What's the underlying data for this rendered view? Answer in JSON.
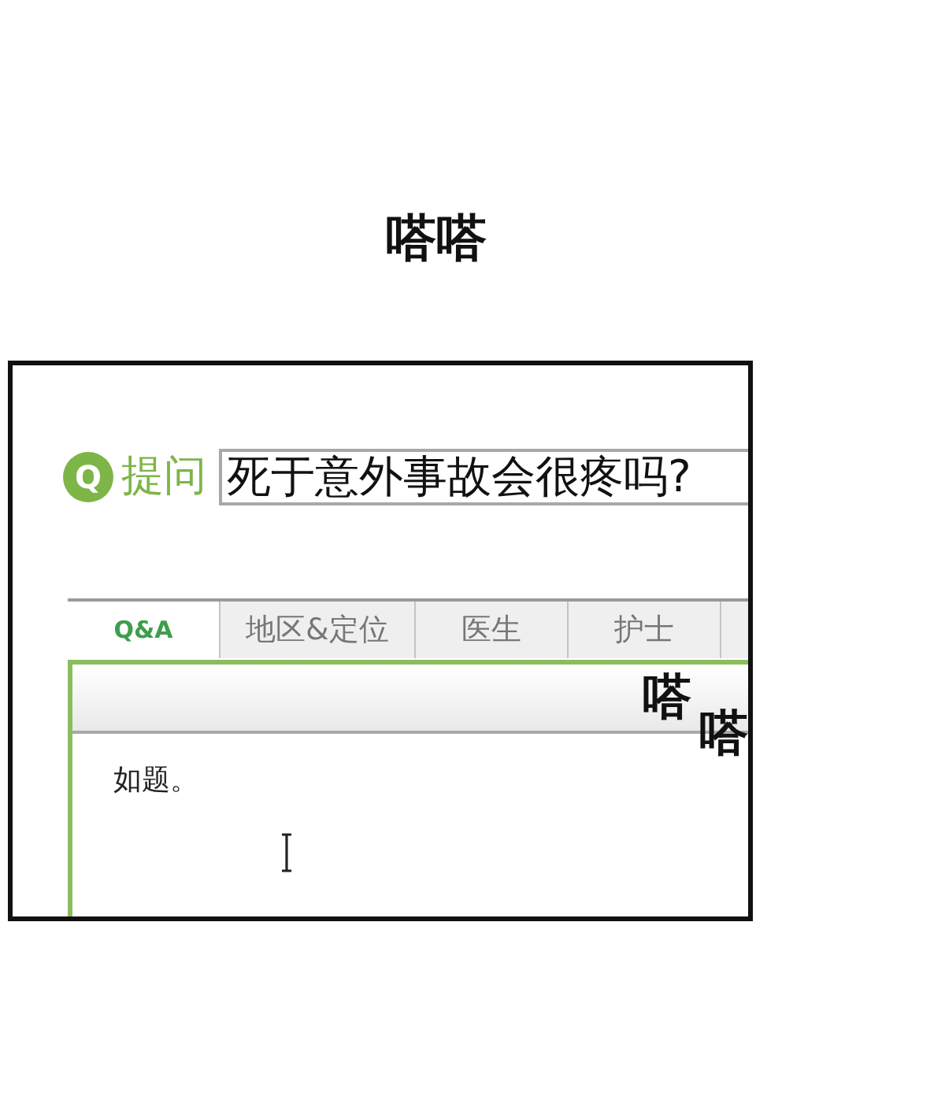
{
  "sound_effect": "嗒嗒",
  "panel": {
    "question": {
      "badge": "Q",
      "label": "提问",
      "value": "死于意外事故会很疼吗?"
    },
    "tabs": [
      {
        "label": "Q&A",
        "selected": true
      },
      {
        "label": "地区&定位",
        "selected": false
      },
      {
        "label": "医生",
        "selected": false
      },
      {
        "label": "护士",
        "selected": false
      }
    ],
    "editor": {
      "text": "如题。"
    },
    "sound_effects": [
      "嗒",
      "嗒"
    ]
  }
}
